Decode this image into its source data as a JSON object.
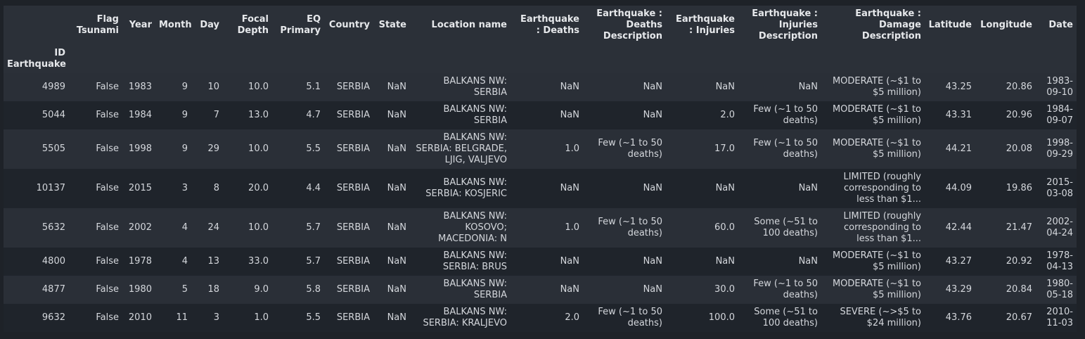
{
  "columns": [
    {
      "key": "flag",
      "label": "Flag Tsunami"
    },
    {
      "key": "year",
      "label": "Year"
    },
    {
      "key": "month",
      "label": "Month"
    },
    {
      "key": "day",
      "label": "Day"
    },
    {
      "key": "focal",
      "label": "Focal Depth"
    },
    {
      "key": "eq",
      "label": "EQ Primary"
    },
    {
      "key": "country",
      "label": "Country"
    },
    {
      "key": "state",
      "label": "State"
    },
    {
      "key": "location",
      "label": "Location name"
    },
    {
      "key": "deaths",
      "label": "Earthquake : Deaths"
    },
    {
      "key": "deaths_desc",
      "label": "Earthquake : Deaths Description"
    },
    {
      "key": "injuries",
      "label": "Earthquake : Injuries"
    },
    {
      "key": "injuries_desc",
      "label": "Earthquake : Injuries Description"
    },
    {
      "key": "damage_desc",
      "label": "Earthquake : Damage Description"
    },
    {
      "key": "lat",
      "label": "Latitude"
    },
    {
      "key": "lon",
      "label": "Longitude"
    },
    {
      "key": "date",
      "label": "Date"
    }
  ],
  "index_label": "ID Earthquake",
  "rows": [
    {
      "id": "4989",
      "flag": "False",
      "year": "1983",
      "month": "9",
      "day": "10",
      "focal": "10.0",
      "eq": "5.1",
      "country": "SERBIA",
      "state": "NaN",
      "location": "BALKANS NW: SERBIA",
      "deaths": "NaN",
      "deaths_desc": "NaN",
      "injuries": "NaN",
      "injuries_desc": "NaN",
      "damage_desc": "MODERATE (~$1 to $5 million)",
      "lat": "43.25",
      "lon": "20.86",
      "date": "1983-09-10"
    },
    {
      "id": "5044",
      "flag": "False",
      "year": "1984",
      "month": "9",
      "day": "7",
      "focal": "13.0",
      "eq": "4.7",
      "country": "SERBIA",
      "state": "NaN",
      "location": "BALKANS NW: SERBIA",
      "deaths": "NaN",
      "deaths_desc": "NaN",
      "injuries": "2.0",
      "injuries_desc": "Few (~1 to 50 deaths)",
      "damage_desc": "MODERATE (~$1 to $5 million)",
      "lat": "43.31",
      "lon": "20.96",
      "date": "1984-09-07"
    },
    {
      "id": "5505",
      "flag": "False",
      "year": "1998",
      "month": "9",
      "day": "29",
      "focal": "10.0",
      "eq": "5.5",
      "country": "SERBIA",
      "state": "NaN",
      "location": "BALKANS NW: SERBIA: BELGRADE, LJIG, VALJEVO",
      "deaths": "1.0",
      "deaths_desc": "Few (~1 to 50 deaths)",
      "injuries": "17.0",
      "injuries_desc": "Few (~1 to 50 deaths)",
      "damage_desc": "MODERATE (~$1 to $5 million)",
      "lat": "44.21",
      "lon": "20.08",
      "date": "1998-09-29"
    },
    {
      "id": "10137",
      "flag": "False",
      "year": "2015",
      "month": "3",
      "day": "8",
      "focal": "20.0",
      "eq": "4.4",
      "country": "SERBIA",
      "state": "NaN",
      "location": "BALKANS NW: SERBIA: KOSJERIC",
      "deaths": "NaN",
      "deaths_desc": "NaN",
      "injuries": "NaN",
      "injuries_desc": "NaN",
      "damage_desc": "LIMITED (roughly corresponding to less than $1...",
      "lat": "44.09",
      "lon": "19.86",
      "date": "2015-03-08"
    },
    {
      "id": "5632",
      "flag": "False",
      "year": "2002",
      "month": "4",
      "day": "24",
      "focal": "10.0",
      "eq": "5.7",
      "country": "SERBIA",
      "state": "NaN",
      "location": "BALKANS NW: KOSOVO; MACEDONIA: N",
      "deaths": "1.0",
      "deaths_desc": "Few (~1 to 50 deaths)",
      "injuries": "60.0",
      "injuries_desc": "Some (~51 to 100 deaths)",
      "damage_desc": "LIMITED (roughly corresponding to less than $1...",
      "lat": "42.44",
      "lon": "21.47",
      "date": "2002-04-24"
    },
    {
      "id": "4800",
      "flag": "False",
      "year": "1978",
      "month": "4",
      "day": "13",
      "focal": "33.0",
      "eq": "5.7",
      "country": "SERBIA",
      "state": "NaN",
      "location": "BALKANS NW: SERBIA: BRUS",
      "deaths": "NaN",
      "deaths_desc": "NaN",
      "injuries": "NaN",
      "injuries_desc": "NaN",
      "damage_desc": "MODERATE (~$1 to $5 million)",
      "lat": "43.27",
      "lon": "20.92",
      "date": "1978-04-13"
    },
    {
      "id": "4877",
      "flag": "False",
      "year": "1980",
      "month": "5",
      "day": "18",
      "focal": "9.0",
      "eq": "5.8",
      "country": "SERBIA",
      "state": "NaN",
      "location": "BALKANS NW: SERBIA",
      "deaths": "NaN",
      "deaths_desc": "NaN",
      "injuries": "30.0",
      "injuries_desc": "Few (~1 to 50 deaths)",
      "damage_desc": "MODERATE (~$1 to $5 million)",
      "lat": "43.29",
      "lon": "20.84",
      "date": "1980-05-18"
    },
    {
      "id": "9632",
      "flag": "False",
      "year": "2010",
      "month": "11",
      "day": "3",
      "focal": "1.0",
      "eq": "5.5",
      "country": "SERBIA",
      "state": "NaN",
      "location": "BALKANS NW: SERBIA: KRALJEVO",
      "deaths": "2.0",
      "deaths_desc": "Few (~1 to 50 deaths)",
      "injuries": "100.0",
      "injuries_desc": "Some (~51 to 100 deaths)",
      "damage_desc": "SEVERE (~>$5 to $24 million)",
      "lat": "43.76",
      "lon": "20.67",
      "date": "2010-11-03"
    }
  ]
}
